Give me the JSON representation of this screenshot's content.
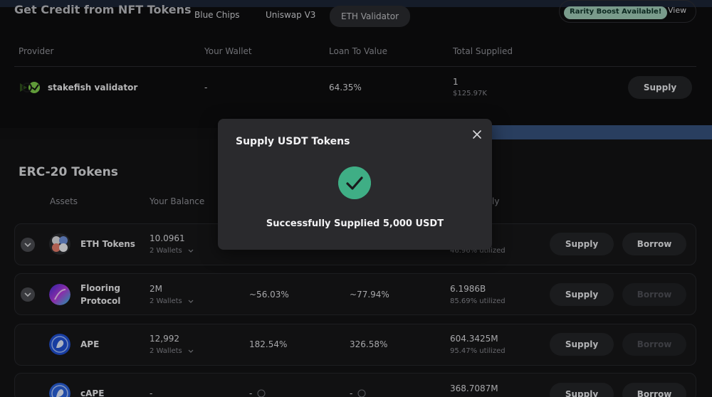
{
  "nft": {
    "title": "Get Credit from NFT Tokens",
    "tabs": [
      {
        "label": "Blue Chips"
      },
      {
        "label": "Uniswap V3"
      },
      {
        "label": "ETH Validator"
      }
    ],
    "rarity_badge": "Rarity Boost Available!",
    "rarity_view": "View",
    "headers": {
      "provider": "Provider",
      "wallet": "Your Wallet",
      "ltv": "Loan To Value",
      "supplied": "Total Supplied"
    },
    "row": {
      "provider": "stakefish validator",
      "wallet": "-",
      "ltv": "64.35%",
      "supplied": "1",
      "supplied_usd": "$125.97K",
      "action": "Supply"
    }
  },
  "erc20": {
    "title": "ERC-20 Tokens",
    "headers": {
      "assets": "Assets",
      "balance": "Your Balance",
      "supply_partial": "ly"
    },
    "rows": [
      {
        "name": "ETH Tokens",
        "balance": "10.0961",
        "wallets": "2 Wallets",
        "apy1": "",
        "apy2": "",
        "total": "",
        "util": "46.96% utilized",
        "supply": "Supply",
        "borrow": "Borrow"
      },
      {
        "name": "Flooring",
        "name2": "Protocol",
        "balance": "2M",
        "wallets": "2 Wallets",
        "apy1": "~56.03%",
        "apy2": "~77.94%",
        "total": "6.1986B",
        "util": "85.69% utilized",
        "supply": "Supply",
        "borrow": "Borrow"
      },
      {
        "name": "APE",
        "balance": "12,992",
        "wallets": "2 Wallets",
        "apy1": "182.54%",
        "apy2": "326.58%",
        "total": "604.3425M",
        "util": "95.47% utilized",
        "supply": "Supply",
        "borrow": "Borrow"
      },
      {
        "name": "cAPE",
        "balance": "-",
        "wallets": "",
        "apy1": "-",
        "apy2": "-",
        "total": "368.7087M",
        "util": "",
        "supply": "Supply",
        "borrow": "Borrow"
      }
    ]
  },
  "modal": {
    "title": "Supply USDT Tokens",
    "message": "Successfully Supplied 5,000 USDT"
  },
  "icons": {
    "close": "close-icon",
    "success": "check-circle-icon",
    "chevron": "chevron-down-icon",
    "info": "info-icon"
  },
  "colors": {
    "success": "#3fae85",
    "rarity_badge": "#9cc7b2",
    "background": "#111113"
  }
}
